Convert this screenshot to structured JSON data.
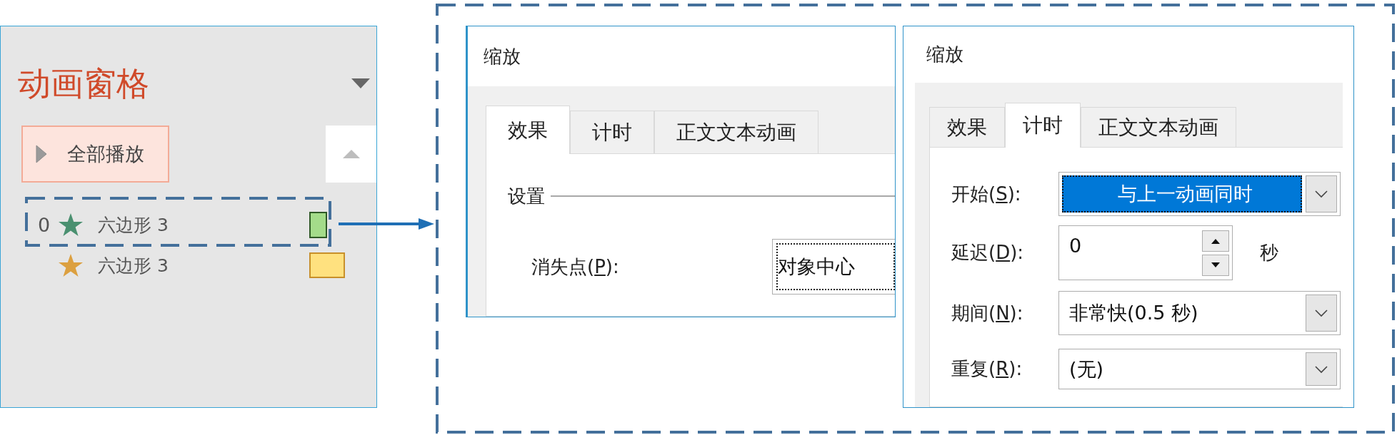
{
  "animation_pane": {
    "title": "动画窗格",
    "play_all_button": "全部播放",
    "items": [
      {
        "number": "0",
        "kind": "entrance",
        "name": "六边形 3"
      },
      {
        "kind": "emphasis",
        "name": "六边形 3"
      }
    ]
  },
  "dialogs": [
    {
      "title": "缩放",
      "tabs": [
        {
          "label": "效果",
          "selected": true
        },
        {
          "label": "计时",
          "selected": false
        },
        {
          "label": "正文文本动画",
          "selected": false
        }
      ],
      "group": "设置",
      "fields": [
        {
          "label": "消失点(P):",
          "kind": "field",
          "value": "对象中心",
          "focused": true
        }
      ]
    },
    {
      "title": "缩放",
      "tabs": [
        {
          "label": "效果",
          "selected": false
        },
        {
          "label": "计时",
          "selected": true
        },
        {
          "label": "正文文本动画",
          "selected": false
        }
      ],
      "fields": [
        {
          "label": "开始(S):",
          "kind": "dropdown",
          "value": "与上一动画同时",
          "focused": true,
          "highlighted": true
        },
        {
          "label": "延迟(D):",
          "kind": "spinner",
          "value": "0",
          "unit": "秒"
        },
        {
          "label": "期间(N):",
          "kind": "dropdown",
          "value": "非常快(0.5 秒)",
          "focused": false,
          "highlighted": false
        },
        {
          "label": "重复(R):",
          "kind": "dropdown",
          "value": "(无)",
          "focused": false,
          "highlighted": false
        }
      ]
    }
  ]
}
